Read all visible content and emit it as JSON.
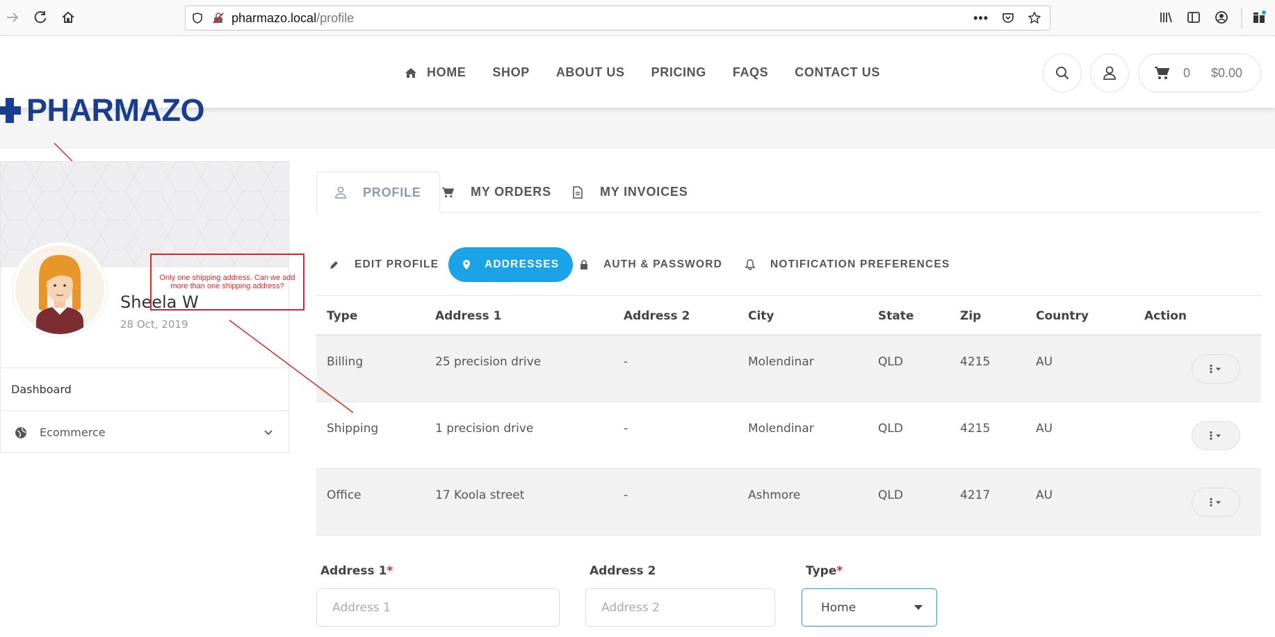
{
  "browser": {
    "url_host": "pharmazo.local",
    "url_path": "/profile"
  },
  "site": {
    "logo_text": "PHARMAZO",
    "nav": [
      "HOME",
      "SHOP",
      "ABOUT US",
      "PRICING",
      "FAQS",
      "CONTACT US"
    ],
    "cart_count": "0",
    "cart_total": "$0.00"
  },
  "profile": {
    "name": "Sheela W",
    "date": "28 Oct, 2019",
    "side_items": [
      "Dashboard",
      "Ecommerce"
    ]
  },
  "tabs": [
    "PROFILE",
    "MY ORDERS",
    "MY INVOICES"
  ],
  "subtabs": [
    "EDIT PROFILE",
    "ADDRESSES",
    "AUTH & PASSWORD",
    "NOTIFICATION PREFERENCES"
  ],
  "table": {
    "headers": [
      "Type",
      "Address 1",
      "Address 2",
      "City",
      "State",
      "Zip",
      "Country",
      "Action"
    ],
    "rows": [
      [
        "Billing",
        "25 precision drive",
        "-",
        "Molendinar",
        "QLD",
        "4215",
        "AU"
      ],
      [
        "Shipping",
        "1 precision drive",
        "-",
        "Molendinar",
        "QLD",
        "4215",
        "AU"
      ],
      [
        "Office",
        "17 Koola street",
        "-",
        "Ashmore",
        "QLD",
        "4217",
        "AU"
      ]
    ]
  },
  "form": {
    "address1_label": "Address 1",
    "address1_placeholder": "Address 1",
    "address2_label": "Address 2",
    "address2_placeholder": "Address 2",
    "type_label": "Type",
    "type_value": "Home",
    "required_mark": "*"
  },
  "annotation": {
    "text": "Only one shipping address. Can we add more than one shipping address?"
  },
  "colors": {
    "accent": "#1aa3e6",
    "brand": "#173e8f",
    "annotation": "#e02424"
  }
}
